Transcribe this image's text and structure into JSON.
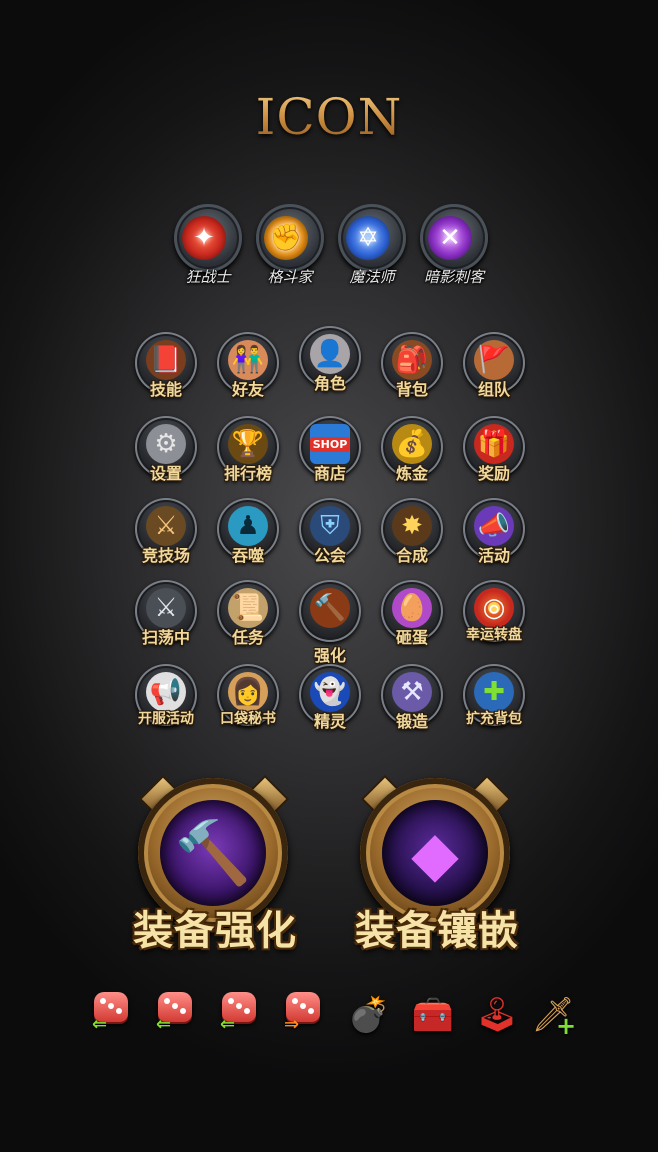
{
  "title": "ICON",
  "classes": [
    {
      "label": "狂战士",
      "icon": "berserker-emblem-icon",
      "color": "#c8281e"
    },
    {
      "label": "格斗家",
      "icon": "fighter-emblem-icon",
      "color": "#e08a12"
    },
    {
      "label": "魔法师",
      "icon": "mage-emblem-icon",
      "color": "#2f63d6"
    },
    {
      "label": "暗影刺客",
      "icon": "assassin-emblem-icon",
      "color": "#8a2fc4"
    }
  ],
  "features": [
    {
      "label": "技能",
      "icon": "skill-book-icon"
    },
    {
      "label": "好友",
      "icon": "friends-icon"
    },
    {
      "label": "角色",
      "icon": "character-portrait-icon"
    },
    {
      "label": "背包",
      "icon": "backpack-icon"
    },
    {
      "label": "组队",
      "icon": "team-flag-icon"
    },
    {
      "label": "设置",
      "icon": "gear-icon"
    },
    {
      "label": "排行榜",
      "icon": "trophy-icon"
    },
    {
      "label": "商店",
      "icon": "shop-icon",
      "sign": "SHOP"
    },
    {
      "label": "炼金",
      "icon": "gold-coins-icon"
    },
    {
      "label": "奖励",
      "icon": "gift-box-icon"
    },
    {
      "label": "竞技场",
      "icon": "crossed-swords-icon"
    },
    {
      "label": "吞噬",
      "icon": "devour-figure-icon"
    },
    {
      "label": "公会",
      "icon": "guild-shield-icon"
    },
    {
      "label": "合成",
      "icon": "combine-star-icon"
    },
    {
      "label": "活动",
      "icon": "megaphone-icon"
    },
    {
      "label": "扫荡中",
      "icon": "sweep-swords-icon"
    },
    {
      "label": "任务",
      "icon": "quest-scroll-icon"
    },
    {
      "label": "强化",
      "icon": "enhance-hammer-icon"
    },
    {
      "label": "砸蛋",
      "icon": "egg-icon"
    },
    {
      "label": "幸运转盘",
      "icon": "lucky-wheel-icon"
    },
    {
      "label": "开服活动",
      "icon": "launch-horn-icon"
    },
    {
      "label": "口袋秘书",
      "icon": "secretary-girl-icon"
    },
    {
      "label": "精灵",
      "icon": "spirit-hood-icon"
    },
    {
      "label": "锻造",
      "icon": "forge-axe-icon"
    },
    {
      "label": "扩充背包",
      "icon": "expand-bag-icon"
    }
  ],
  "big_buttons": [
    {
      "label": "装备强化",
      "icon": "flaming-hammer-icon"
    },
    {
      "label": "装备镶嵌",
      "icon": "purple-gem-icon"
    }
  ],
  "mini_icons": [
    {
      "icon": "dice-arrow-left-icon",
      "arrow": "⇐",
      "arrow_color": "#7fe033"
    },
    {
      "icon": "dice-arrow-left-icon",
      "arrow": "⇐",
      "arrow_color": "#7fe033"
    },
    {
      "icon": "dice-arrow-left-icon",
      "arrow": "⇐",
      "arrow_color": "#7fe033"
    },
    {
      "icon": "dice-arrow-right-icon",
      "arrow": "⇒",
      "arrow_color": "#ff8a1f"
    },
    {
      "icon": "skull-bomb-icon"
    },
    {
      "icon": "treasure-chest-icon"
    },
    {
      "icon": "joystick-icon"
    },
    {
      "icon": "add-sword-icon"
    }
  ]
}
